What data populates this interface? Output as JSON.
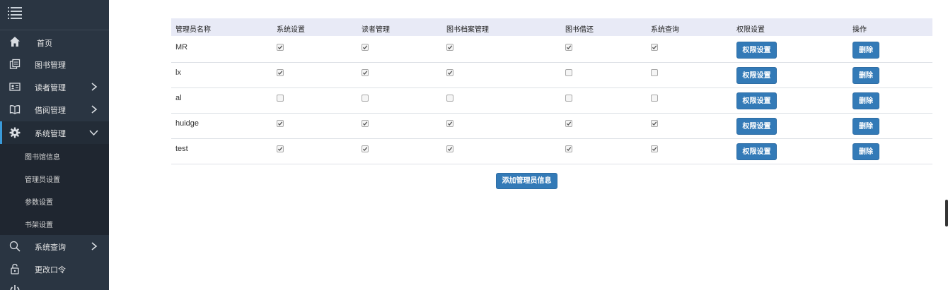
{
  "sidebar": {
    "items": [
      {
        "label": "首页",
        "icon": "home-icon"
      },
      {
        "label": "图书管理",
        "icon": "books-icon"
      },
      {
        "label": "读者管理",
        "icon": "reader-card-icon",
        "has_arrow": true
      },
      {
        "label": "借阅管理",
        "icon": "open-book-icon",
        "has_arrow": true
      },
      {
        "label": "系统管理",
        "icon": "gear-icon",
        "has_arrow": true,
        "expanded": true
      },
      {
        "label": "系统查询",
        "icon": "search-icon",
        "has_arrow": true
      },
      {
        "label": "更改口令",
        "icon": "lock-icon"
      }
    ],
    "submenu": [
      {
        "label": "图书馆信息"
      },
      {
        "label": "管理员设置"
      },
      {
        "label": "参数设置"
      },
      {
        "label": "书架设置"
      }
    ],
    "accent_color": "#3a9ad9"
  },
  "table": {
    "headers": [
      "管理员名称",
      "系统设置",
      "读者管理",
      "图书档案管理",
      "图书借还",
      "系统查询",
      "权限设置",
      "操作"
    ],
    "rows": [
      {
        "name": "MR",
        "perms": [
          true,
          true,
          true,
          true,
          true
        ]
      },
      {
        "name": "lx",
        "perms": [
          true,
          true,
          true,
          false,
          false
        ]
      },
      {
        "name": "al",
        "perms": [
          false,
          false,
          false,
          false,
          false
        ]
      },
      {
        "name": "huidge",
        "perms": [
          true,
          true,
          true,
          true,
          true
        ]
      },
      {
        "name": "test",
        "perms": [
          true,
          true,
          true,
          true,
          true
        ]
      }
    ],
    "perm_button_label": "权限设置",
    "delete_button_label": "删除"
  },
  "add_button_label": "添加管理员信息",
  "button_color": "#337ab7"
}
